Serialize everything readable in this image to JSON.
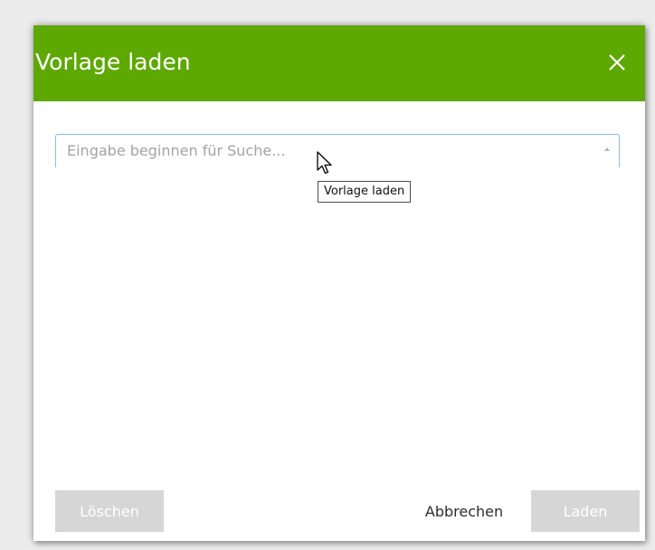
{
  "dialog": {
    "title": "Vorlage laden",
    "close_icon": "close-icon",
    "search": {
      "placeholder": "Eingabe beginnen für Suche...",
      "value": "",
      "dropdown_icon": "chevron-up-icon"
    },
    "tooltip": "Vorlage laden",
    "buttons": {
      "delete_label": "Löschen",
      "cancel_label": "Abbrechen",
      "load_label": "Laden"
    }
  },
  "colors": {
    "header": "#5da801",
    "disabled_button": "#d6d6d6",
    "input_border": "#8fb8e6"
  }
}
